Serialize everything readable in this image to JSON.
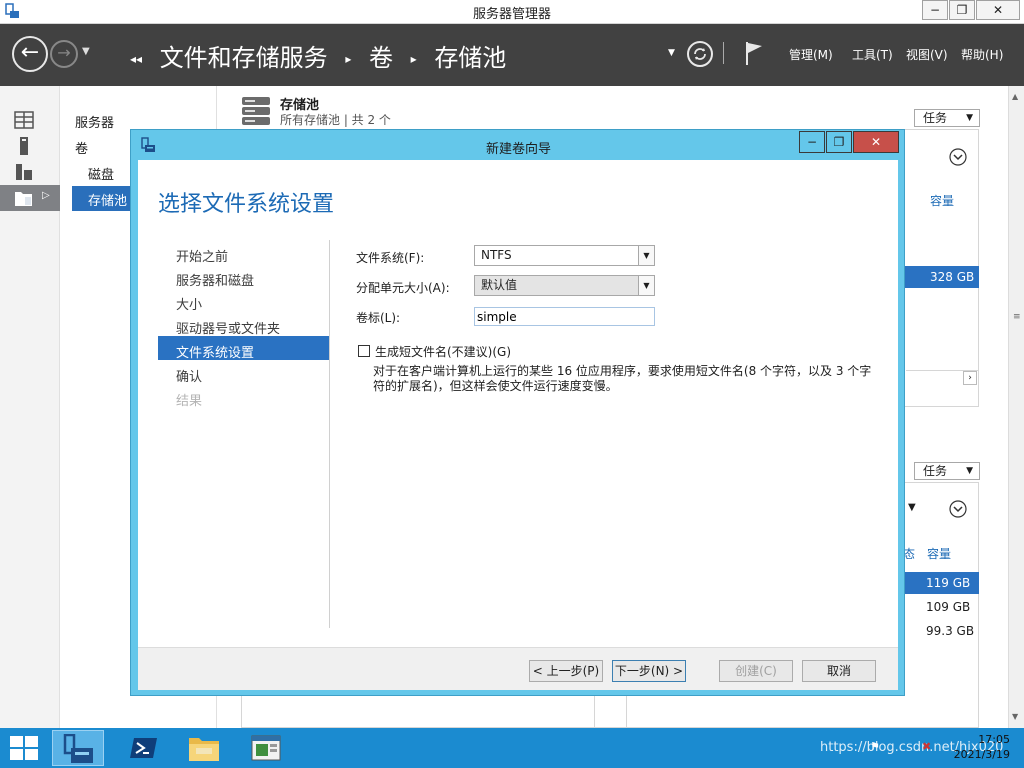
{
  "window": {
    "title": "服务器管理器",
    "minimize": "−",
    "restore": "❐",
    "close": "✕"
  },
  "header": {
    "breadcrumb": [
      "文件和存储服务",
      "卷",
      "存储池"
    ],
    "menus": {
      "manage": "管理(M)",
      "tools": "工具(T)",
      "view": "视图(V)",
      "help": "帮助(H)"
    }
  },
  "nav": {
    "items": [
      "服务器",
      "卷",
      "磁盘",
      "存储池"
    ],
    "selected": "存储池"
  },
  "content": {
    "pool_title": "存储池",
    "pool_subtitle": "所有存储池 | 共 2 个",
    "tasks_label": "任务",
    "capacity_header": "容量",
    "status_header_fragment": "态",
    "upper_capacity": "328 GB",
    "lower_capacities": [
      "119 GB",
      "109 GB",
      "99.3 GB"
    ]
  },
  "dialog": {
    "title": "新建卷向导",
    "heading": "选择文件系统设置",
    "steps": [
      {
        "label": "开始之前",
        "state": "normal"
      },
      {
        "label": "服务器和磁盘",
        "state": "normal"
      },
      {
        "label": "大小",
        "state": "normal"
      },
      {
        "label": "驱动器号或文件夹",
        "state": "normal"
      },
      {
        "label": "文件系统设置",
        "state": "selected"
      },
      {
        "label": "确认",
        "state": "normal"
      },
      {
        "label": "结果",
        "state": "disabled"
      }
    ],
    "filesystem_label": "文件系统(F):",
    "filesystem_value": "NTFS",
    "alloc_label": "分配单元大小(A):",
    "alloc_value": "默认值",
    "volume_label_label": "卷标(L):",
    "volume_label_value": "simple",
    "shortname_label": "生成短文件名(不建议)(G)",
    "shortname_checked": false,
    "shortname_desc": "对于在客户端计算机上运行的某些 16 位应用程序，要求使用短文件名(8 个字符，以及 3 个字符的扩展名)，但这样会使文件运行速度变慢。",
    "buttons": {
      "back": "< 上一步(P)",
      "next": "下一步(N) >",
      "create": "创建(C)",
      "cancel": "取消"
    }
  },
  "taskbar": {
    "time": "17:05",
    "date": "2021/3/19",
    "watermark": "https://blog.csdn.net/hjx020"
  },
  "colors": {
    "header_bg": "#414141",
    "accent": "#2a6fbb",
    "dialog_frame": "#64c7ea",
    "taskbar": "#1b8bd0",
    "close_button": "#c7504a"
  }
}
